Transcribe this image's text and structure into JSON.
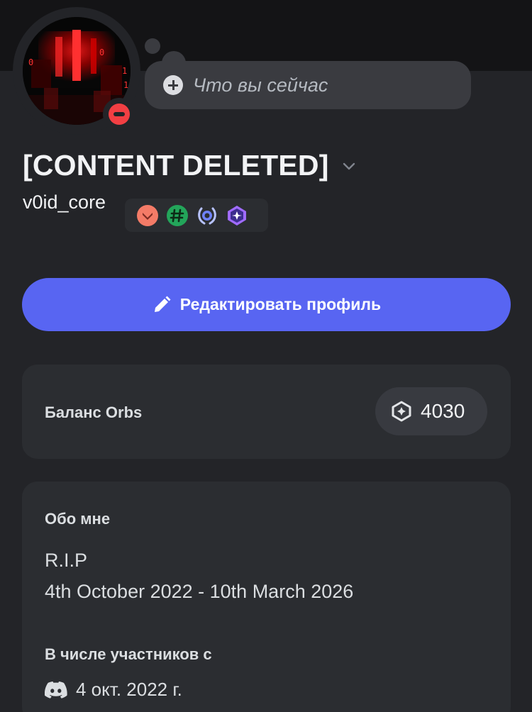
{
  "profile": {
    "status_placeholder": "Что вы сейчас",
    "display_name": "[CONTENT DELETED]",
    "username": "v0id_core",
    "status": "do-not-disturb",
    "avatar_text": [
      "0",
      "1",
      "0",
      "1"
    ]
  },
  "badges": [
    {
      "icon": "hypesquad-bravery-icon",
      "color": "#f47b67"
    },
    {
      "icon": "hashtag-badge-icon",
      "color": "#23a55a"
    },
    {
      "icon": "laurel-badge-icon",
      "color": "#7b8cff"
    },
    {
      "icon": "orb-badge-icon",
      "color": "#a06bff"
    }
  ],
  "actions": {
    "edit_profile_label": "Редактировать профиль"
  },
  "orbs": {
    "label": "Баланс Orbs",
    "value": "4030"
  },
  "about": {
    "title": "Обо мне",
    "line1": "R.I.P",
    "line2": "4th October 2022 - 10th March 2026"
  },
  "member_since": {
    "title": "В числе участников с",
    "date": "4 окт. 2022 г."
  },
  "colors": {
    "accent": "#5865f2",
    "dnd": "#f23f43",
    "background": "#232428",
    "card": "#2b2d31"
  }
}
